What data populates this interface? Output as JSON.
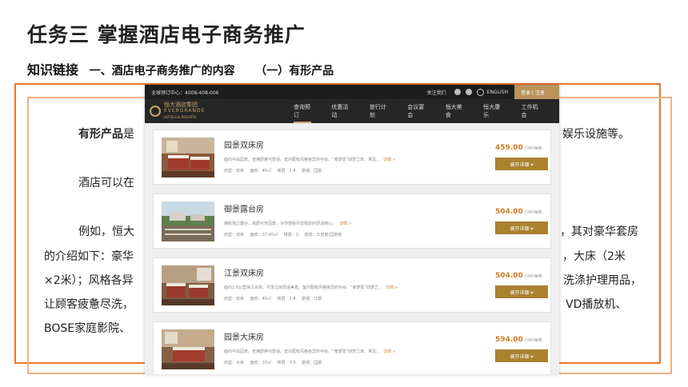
{
  "slide": {
    "title": "任务三   掌握酒店电子商务推广",
    "subtitle_1": "知识链接",
    "subtitle_2": "一、酒店电子商务推广的内容",
    "subtitle_3": "（一）有形产品"
  },
  "body": {
    "p1_bold": "有形产品",
    "p1_text": "是",
    "p1_tail": "娱乐设施等。",
    "p2": "酒店可以在",
    "p3_head": "例如，恒大",
    "p3_tail": "，其对豪华套房",
    "p4_head": "的介绍如下：豪华",
    "p4_tail": "，大床（2米",
    "p5_head": "×2米）；风格各异",
    "p5_tail": "洗涤护理用品，",
    "p6_head": "让顾客疲惫尽洗，",
    "p6_tail": "VD播放机、",
    "p7_head": "BOSE家庭影院、"
  },
  "site": {
    "topbar": {
      "hotline": "全球预订中心：4008-408-006",
      "follow": "关注我们",
      "lang": "ENGLISH",
      "login": "登录 | 注册"
    },
    "logo": {
      "line1": "恒大酒店集团",
      "line2": "EVERGRANDE",
      "line3": "HOTELS & RESORTS"
    },
    "nav": [
      "查询预订",
      "优惠活动",
      "旅行计划",
      "会议宴会",
      "恒大美食",
      "恒大康乐",
      "工作机会"
    ],
    "rooms": [
      {
        "name": "园景双床房",
        "desc": "面向半岛园景，坐拥舒爽与舒适。室内配有风格各异的手绘、“南梦思”四梦之床、埃及...",
        "more": "详细 >",
        "spec": "床型：双床   面积：45㎡   楼层：2-4   景观：园景",
        "price": "459.00",
        "unit": "CNY/每晚",
        "button": "展开详细 ▾"
      },
      {
        "name": "御景露台房",
        "desc": "拥有独立露台，高居可览园景，令你感受尽享独享的舒适随心。",
        "more": "详细 >",
        "spec": "床型：双床   面积：37-45㎡   楼层：3   景观：江景房/园景房",
        "price": "504.00",
        "unit": "CNY/每晚",
        "button": "展开详细 ▾"
      },
      {
        "name": "江景双床房",
        "desc": "面向2.8公里珠江水岸，尽享江岸舒适美景。室内配有风格各异的手绘、“南梦思”四梦之...",
        "more": "详细 >",
        "spec": "床型：双床   面积：45㎡   楼层：2-4   景观：江景",
        "price": "504.00",
        "unit": "CNY/每晚",
        "button": "展开详细 ▾"
      },
      {
        "name": "园景大床房",
        "desc": "面向半岛园景，坐拥舒爽与舒适。室内配有风格各异的手绘、“南梦思”四梦之床、埃及...",
        "more": "详细 >",
        "spec": "床型：大床   面积：37㎡   楼层：3-5   景观：园景",
        "price": "594.00",
        "unit": "CNY/每晚",
        "button": "展开详细 ▾"
      }
    ]
  },
  "colors": {
    "accent_orange": "#e8772f",
    "gold": "#c9a46a",
    "button": "#a9812f",
    "price": "#d07d1f"
  }
}
